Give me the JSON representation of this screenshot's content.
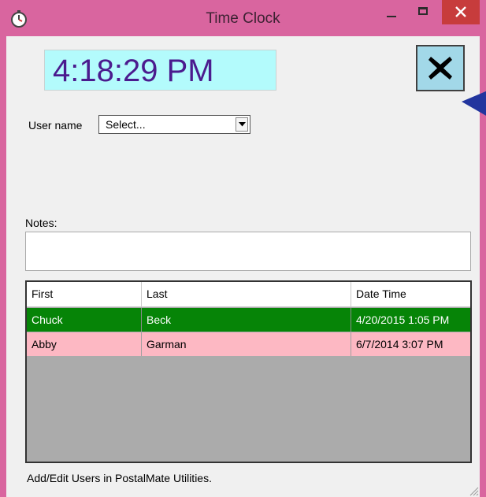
{
  "window": {
    "title": "Time Clock",
    "icon": "stopwatch-icon",
    "controls": [
      "minimize-icon",
      "maximize-icon",
      "close-icon"
    ],
    "titlebar_color": "#d9659f"
  },
  "clock": {
    "time": "4:18:29 PM",
    "background": "#b3fbfc",
    "color": "#4b1b8e"
  },
  "exit_button": {
    "icon": "close-x-icon",
    "background": "#a2d8e8"
  },
  "form": {
    "user_label": "User name",
    "user_value": "Select...",
    "notes_label": "Notes:",
    "notes_value": ""
  },
  "grid": {
    "columns": [
      "First",
      "Last",
      "Date Time"
    ],
    "rows": [
      {
        "first": "Chuck",
        "last": "Beck",
        "datetime": "4/20/2015 1:05 PM",
        "color": "#068407"
      },
      {
        "first": "Abby",
        "last": "Garman",
        "datetime": "6/7/2014 3:07 PM",
        "color": "#fdb8c3"
      }
    ]
  },
  "footer": {
    "text": "Add/Edit Users in PostalMate Utilities."
  }
}
